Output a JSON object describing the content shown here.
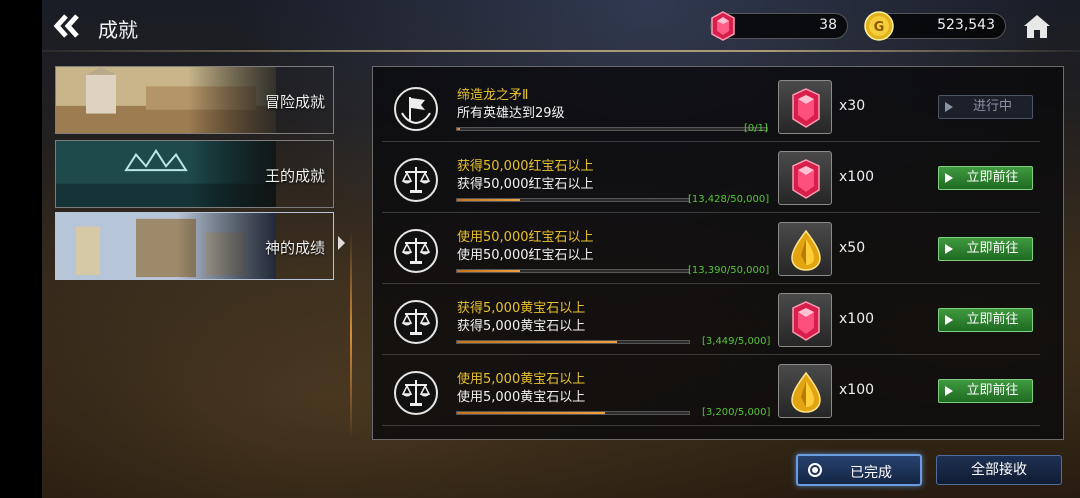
{
  "header": {
    "title": "成就",
    "back_icon": "double-chevron-left-icon",
    "home_icon": "home-icon"
  },
  "currencies": {
    "ruby": {
      "icon": "ruby-gem-icon",
      "value": "38"
    },
    "gold": {
      "icon": "gold-coin-icon",
      "value": "523,543"
    }
  },
  "tabs": [
    {
      "label": "冒险成就",
      "active": false
    },
    {
      "label": "王的成就",
      "active": false
    },
    {
      "label": "神的成绩",
      "active": true
    }
  ],
  "achievements": [
    {
      "name": "缔造龙之矛Ⅱ",
      "desc": "所有英雄达到29级",
      "progress_text": "[0/1]",
      "progress": 0.0,
      "reward_icon": "ruby-gem-icon",
      "reward_qty": "x30",
      "action_label": "进行中",
      "action_type": "progress",
      "emblem": "flag-emblem-icon"
    },
    {
      "name": "获得50,000红宝石以上",
      "desc": "获得50,000红宝石以上",
      "progress_text": "[13,428/50,000]",
      "progress": 0.27,
      "reward_icon": "ruby-gem-icon",
      "reward_qty": "x100",
      "action_label": "立即前往",
      "action_type": "go",
      "emblem": "scales-emblem-icon"
    },
    {
      "name": "使用50,000红宝石以上",
      "desc": "使用50,000红宝石以上",
      "progress_text": "[13,390/50,000]",
      "progress": 0.27,
      "reward_icon": "topaz-gem-icon",
      "reward_qty": "x50",
      "action_label": "立即前往",
      "action_type": "go",
      "emblem": "scales-emblem-icon"
    },
    {
      "name": "获得5,000黄宝石以上",
      "desc": "获得5,000黄宝石以上",
      "progress_text": "[3,449/5,000]",
      "progress": 0.69,
      "reward_icon": "ruby-gem-icon",
      "reward_qty": "x100",
      "action_label": "立即前往",
      "action_type": "go",
      "emblem": "scales-emblem-icon"
    },
    {
      "name": "使用5,000黄宝石以上",
      "desc": "使用5,000黄宝石以上",
      "progress_text": "[3,200/5,000]",
      "progress": 0.64,
      "reward_icon": "topaz-gem-icon",
      "reward_qty": "x100",
      "action_label": "立即前往",
      "action_type": "go",
      "emblem": "scales-emblem-icon"
    }
  ],
  "footer": {
    "completed_label": "已完成",
    "claim_all_label": "全部接收"
  },
  "colors": {
    "achievement_name": "#e7c22f",
    "progress_count": "#59c43a",
    "go_button": "#2f8a33",
    "progress_fill": "#e08a2c"
  }
}
